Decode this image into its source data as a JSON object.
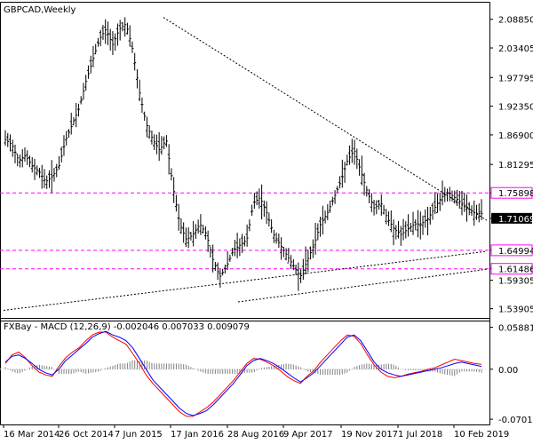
{
  "header": {
    "symbol_label": "GBPCAD,Weekly"
  },
  "indicator": {
    "label": "FXBay - MACD (12,26,9) -0.002046 0.007033 0.009079"
  },
  "colors": {
    "background": "#ffffff",
    "bars": "#000000",
    "level_line": "#ff00ff",
    "trend_line": "#000000",
    "macd_line": "#0000ff",
    "signal_line": "#ff0000",
    "histogram": "#808080",
    "current_price_bg": "#000000",
    "current_price_text": "#ffffff"
  },
  "chart_data": [
    {
      "type": "ohlc",
      "title": "GBPCAD,Weekly",
      "ylim": [
        1.525,
        2.115
      ],
      "price_ticks": [
        "2.08850",
        "2.03405",
        "1.97795",
        "1.92350",
        "1.86900",
        "1.81295",
        "1.75898",
        "1.71069",
        "1.64994",
        "1.61486",
        "1.59305",
        "1.53905"
      ],
      "date_ticks": [
        "16 Mar 2014",
        "26 Oct 2014",
        "7 Jun 2015",
        "17 Jan 2016",
        "28 Aug 2016",
        "9 Apr 2017",
        "19 Nov 2017",
        "1 Jul 2018",
        "10 Feb 2019"
      ],
      "levels": [
        {
          "value": "1.75898",
          "price": 1.75898
        },
        {
          "value": "1.64994",
          "price": 1.64994
        },
        {
          "value": "1.61486",
          "price": 1.61486
        }
      ],
      "current_price": {
        "value": "1.71069",
        "price": 1.71069
      },
      "trendlines": [
        {
          "from": [
            2.09,
            1.707
          ],
          "note": "descending"
        },
        {
          "from": [
            1.535,
            1.613
          ],
          "note": "ascending"
        }
      ],
      "close_path": [
        1.86,
        1.85,
        1.82,
        1.83,
        1.81,
        1.8,
        1.78,
        1.79,
        1.81,
        1.86,
        1.89,
        1.92,
        1.97,
        2.01,
        2.05,
        2.07,
        2.04,
        2.07,
        2.08,
        2.03,
        1.95,
        1.89,
        1.86,
        1.84,
        1.86,
        1.77,
        1.7,
        1.67,
        1.68,
        1.7,
        1.68,
        1.63,
        1.6,
        1.62,
        1.65,
        1.66,
        1.67,
        1.74,
        1.75,
        1.72,
        1.68,
        1.66,
        1.64,
        1.62,
        1.6,
        1.63,
        1.66,
        1.7,
        1.72,
        1.75,
        1.78,
        1.82,
        1.84,
        1.8,
        1.76,
        1.73,
        1.74,
        1.71,
        1.69,
        1.68,
        1.69,
        1.7,
        1.7,
        1.71,
        1.73,
        1.75,
        1.76,
        1.75,
        1.74,
        1.73,
        1.72,
        1.72
      ],
      "series": [
        {
          "name": "GBPCAD",
          "kind": "price-bars"
        }
      ]
    },
    {
      "type": "line",
      "title": "FXBay - MACD (12,26,9) -0.002046 0.007033 0.009079",
      "ylim": [
        -0.075,
        0.062
      ],
      "y_ticks": [
        "0.058813",
        "0.00",
        "-0.070144"
      ],
      "series": [
        {
          "name": "MACD",
          "color": "#0000ff",
          "values": [
            0.01,
            0.018,
            0.02,
            0.015,
            0.008,
            0.0,
            -0.005,
            -0.008,
            0.0,
            0.012,
            0.02,
            0.028,
            0.036,
            0.045,
            0.05,
            0.053,
            0.048,
            0.045,
            0.04,
            0.03,
            0.015,
            0.0,
            -0.015,
            -0.025,
            -0.035,
            -0.045,
            -0.055,
            -0.062,
            -0.065,
            -0.062,
            -0.058,
            -0.05,
            -0.04,
            -0.03,
            -0.02,
            -0.008,
            0.005,
            0.012,
            0.015,
            0.012,
            0.008,
            0.002,
            -0.005,
            -0.012,
            -0.018,
            -0.012,
            -0.005,
            0.005,
            0.015,
            0.025,
            0.035,
            0.045,
            0.048,
            0.04,
            0.025,
            0.01,
            0.0,
            -0.005,
            -0.008,
            -0.01,
            -0.008,
            -0.006,
            -0.004,
            -0.002,
            0.0,
            0.002,
            0.005,
            0.008,
            0.01,
            0.008,
            0.006,
            0.004
          ]
        },
        {
          "name": "Signal",
          "color": "#ff0000",
          "values": [
            0.008,
            0.02,
            0.024,
            0.016,
            0.005,
            -0.004,
            -0.008,
            -0.01,
            0.004,
            0.016,
            0.024,
            0.03,
            0.04,
            0.048,
            0.052,
            0.052,
            0.045,
            0.04,
            0.035,
            0.022,
            0.008,
            -0.008,
            -0.02,
            -0.03,
            -0.04,
            -0.05,
            -0.06,
            -0.066,
            -0.066,
            -0.06,
            -0.054,
            -0.046,
            -0.036,
            -0.026,
            -0.016,
            -0.004,
            0.008,
            0.015,
            0.014,
            0.01,
            0.005,
            -0.002,
            -0.01,
            -0.016,
            -0.02,
            -0.01,
            -0.002,
            0.01,
            0.02,
            0.03,
            0.04,
            0.048,
            0.046,
            0.036,
            0.02,
            0.006,
            -0.004,
            -0.01,
            -0.012,
            -0.01,
            -0.007,
            -0.005,
            -0.003,
            0.0,
            0.002,
            0.006,
            0.01,
            0.014,
            0.012,
            0.01,
            0.008,
            0.007
          ]
        },
        {
          "name": "Histogram",
          "color": "#808080",
          "kind": "bars"
        }
      ]
    }
  ]
}
